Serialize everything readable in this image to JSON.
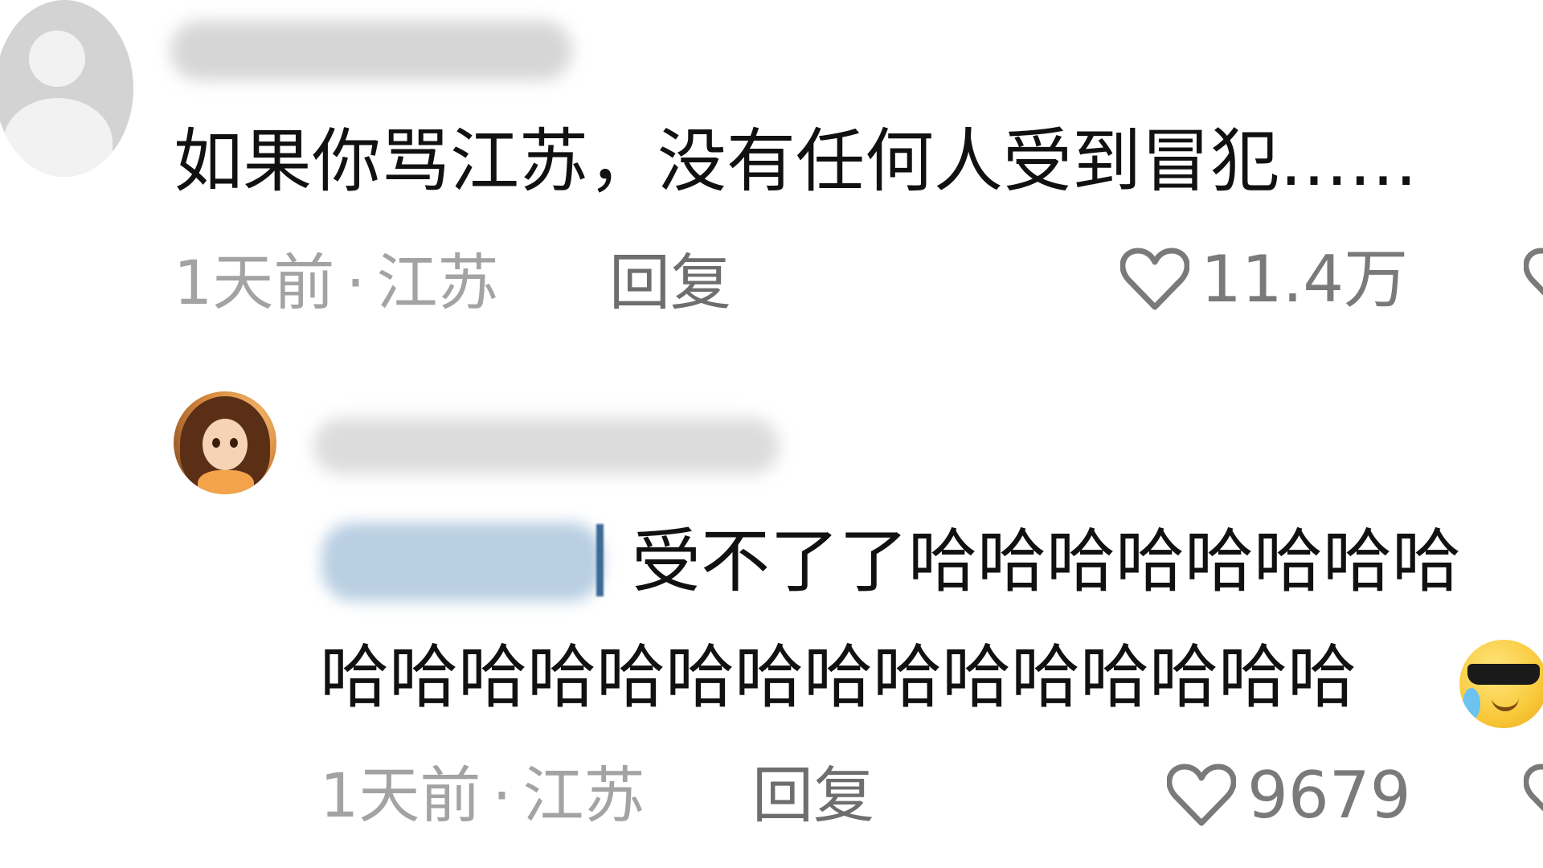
{
  "comments": [
    {
      "text": "如果你骂江苏，没有任何人受到冒犯……",
      "time": "1天前",
      "separator": "·",
      "location": "江苏",
      "reply_label": "回复",
      "likes": "11.4万",
      "avatar": "default-user-avatar"
    },
    {
      "text_line1": "受不了了哈哈哈哈哈哈哈哈",
      "text_line2": "哈哈哈哈哈哈哈哈哈哈哈哈哈哈哈",
      "emoji": "sunglasses-tears-emoji",
      "time": "1天前",
      "separator": "·",
      "location": "江苏",
      "reply_label": "回复",
      "likes": "9679",
      "avatar": "cartoon-girl-avatar"
    }
  ],
  "colors": {
    "text": "#111111",
    "meta": "#a3a3a3",
    "reply": "#6e6e6e",
    "like": "#7a7a7a",
    "mention_blur": "#b9cfe2"
  }
}
